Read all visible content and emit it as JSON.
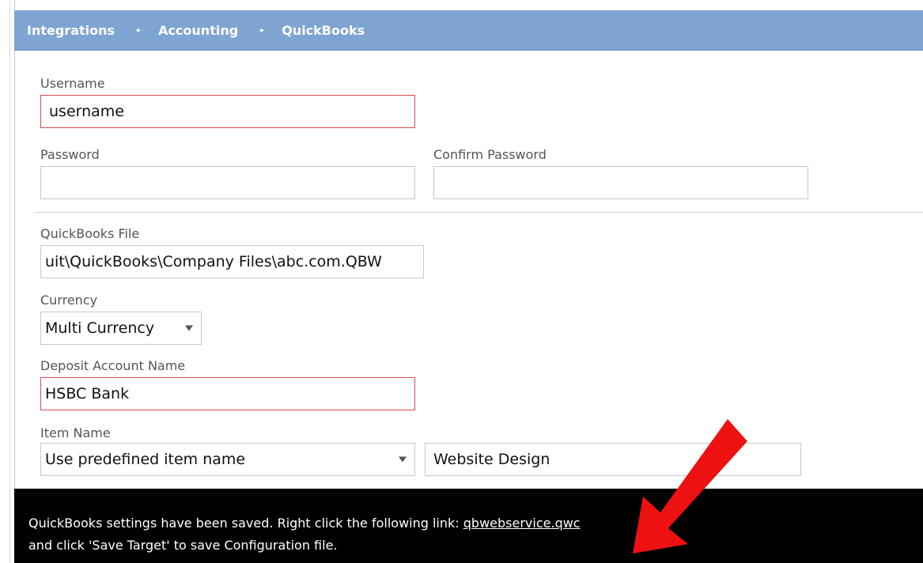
{
  "breadcrumb": {
    "items": [
      "Integrations",
      "Accounting",
      "QuickBooks"
    ],
    "separator": "▸"
  },
  "form": {
    "username": {
      "label": "Username",
      "value": "username",
      "state": "error"
    },
    "password": {
      "label": "Password",
      "value": ""
    },
    "confirm_password": {
      "label": "Confirm Password",
      "value": ""
    },
    "quickbooks_file": {
      "label": "QuickBooks File",
      "value": "uit\\QuickBooks\\Company Files\\abc.com.QBW"
    },
    "currency": {
      "label": "Currency",
      "selected": "Multi Currency"
    },
    "deposit_account": {
      "label": "Deposit Account Name",
      "value": "HSBC Bank",
      "state": "error"
    },
    "item_name": {
      "label": "Item Name",
      "selected": "Use predefined item name",
      "value": "Website Design"
    }
  },
  "notice": {
    "line1_prefix": "QuickBooks settings have been saved. Right click the following link: ",
    "link_text": "qbwebservice.qwc",
    "line2": "and click 'Save Target' to save Configuration file."
  },
  "colors": {
    "header_bg": "#7ea4d2",
    "error_border": "#e24b4b",
    "notice_bg": "#000000",
    "annotation_arrow": "#ee1111"
  },
  "icons": {
    "breadcrumb_separator": "caret-right-icon",
    "dropdown": "chevron-down-icon",
    "annotation": "red-arrow-icon"
  }
}
